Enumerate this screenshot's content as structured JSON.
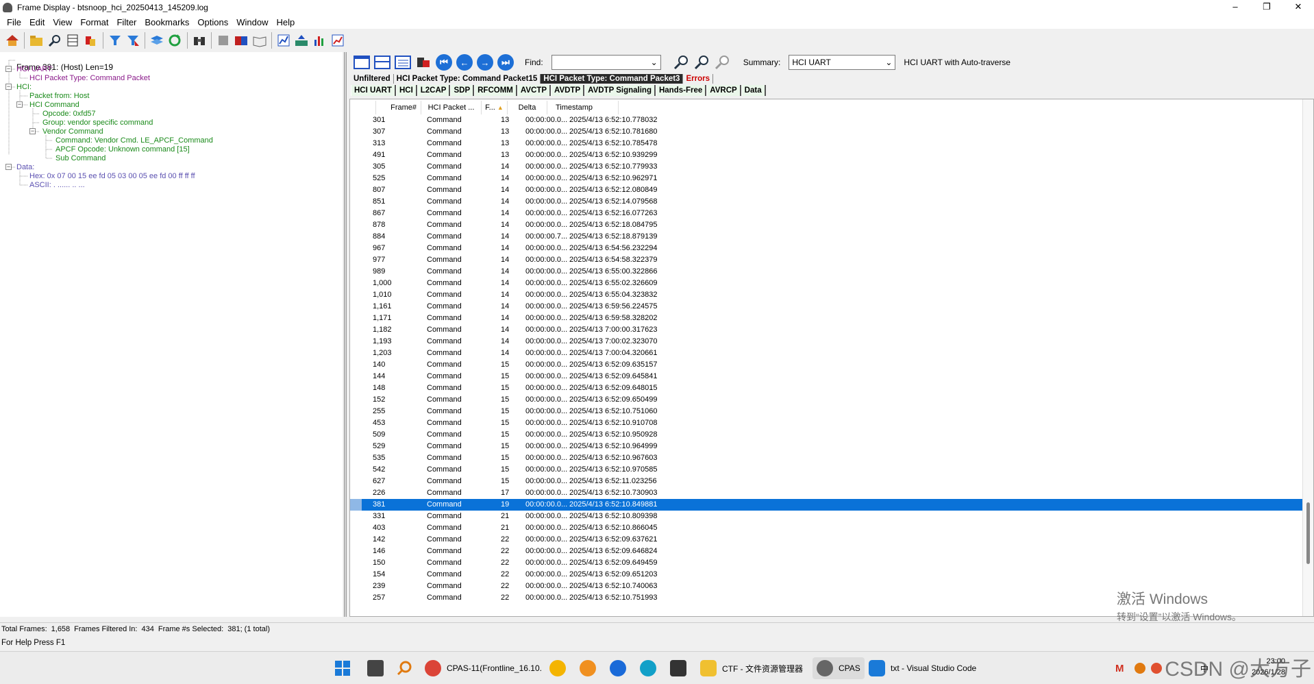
{
  "window": {
    "title": "Frame Display - btsnoop_hci_20250413_145209.log",
    "min": "–",
    "max": "❐",
    "close": "✕"
  },
  "menu": [
    "File",
    "Edit",
    "View",
    "Format",
    "Filter",
    "Bookmarks",
    "Options",
    "Window",
    "Help"
  ],
  "tree": {
    "frame": "Frame 381: (Host) Len=19",
    "hci_uart": "HCI UART:",
    "packet_type": "HCI Packet Type: Command Packet",
    "hci": "HCI:",
    "packet_from": "Packet from: Host",
    "hci_command": "HCI Command",
    "opcode": "Opcode: 0xfd57",
    "group": "Group: vendor specific command",
    "vendor_command": "Vendor Command",
    "command": "Command: Vendor Cmd. LE_APCF_Command",
    "apcf": "APCF Opcode: Unknown command [15]",
    "sub_command": "Sub Command",
    "data": "Data:",
    "hex": "Hex: 0x 07 00 15 ee fd 05 03 00 05 ee fd 00 ff ff ff",
    "ascii": "ASCII: . ...... .. ..."
  },
  "find": {
    "label": "Find:",
    "value": ""
  },
  "summary": {
    "label": "Summary:",
    "value": "HCI UART",
    "description": "HCI UART with Auto-traverse"
  },
  "filter_tabs": [
    {
      "label": "Unfiltered",
      "state": "normal"
    },
    {
      "label": "HCI Packet Type: Command Packet15",
      "state": "normal"
    },
    {
      "label": "HCI Packet Type: Command Packet3",
      "state": "active"
    },
    {
      "label": "Errors",
      "state": "error"
    }
  ],
  "protocol_tabs": [
    "HCI UART",
    "HCI",
    "L2CAP",
    "SDP",
    "RFCOMM",
    "AVCTP",
    "AVDTP",
    "AVDTP Signaling",
    "Hands-Free",
    "AVRCP",
    "Data"
  ],
  "columns": [
    "Frame#",
    "HCI Packet ...",
    "F...",
    "Delta",
    "Timestamp"
  ],
  "rows": [
    [
      "301",
      "Command",
      "13",
      "00:00:00.0...",
      "2025/4/13 6:52:10.778032"
    ],
    [
      "307",
      "Command",
      "13",
      "00:00:00.0...",
      "2025/4/13 6:52:10.781680"
    ],
    [
      "313",
      "Command",
      "13",
      "00:00:00.0...",
      "2025/4/13 6:52:10.785478"
    ],
    [
      "491",
      "Command",
      "13",
      "00:00:00.0...",
      "2025/4/13 6:52:10.939299"
    ],
    [
      "305",
      "Command",
      "14",
      "00:00:00.0...",
      "2025/4/13 6:52:10.779933"
    ],
    [
      "525",
      "Command",
      "14",
      "00:00:00.0...",
      "2025/4/13 6:52:10.962971"
    ],
    [
      "807",
      "Command",
      "14",
      "00:00:00.0...",
      "2025/4/13 6:52:12.080849"
    ],
    [
      "851",
      "Command",
      "14",
      "00:00:00.0...",
      "2025/4/13 6:52:14.079568"
    ],
    [
      "867",
      "Command",
      "14",
      "00:00:00.0...",
      "2025/4/13 6:52:16.077263"
    ],
    [
      "878",
      "Command",
      "14",
      "00:00:00.0...",
      "2025/4/13 6:52:18.084795"
    ],
    [
      "884",
      "Command",
      "14",
      "00:00:00.7...",
      "2025/4/13 6:52:18.879139"
    ],
    [
      "967",
      "Command",
      "14",
      "00:00:00.0...",
      "2025/4/13 6:54:56.232294"
    ],
    [
      "977",
      "Command",
      "14",
      "00:00:00.0...",
      "2025/4/13 6:54:58.322379"
    ],
    [
      "989",
      "Command",
      "14",
      "00:00:00.0...",
      "2025/4/13 6:55:00.322866"
    ],
    [
      "1,000",
      "Command",
      "14",
      "00:00:00.0...",
      "2025/4/13 6:55:02.326609"
    ],
    [
      "1,010",
      "Command",
      "14",
      "00:00:00.0...",
      "2025/4/13 6:55:04.323832"
    ],
    [
      "1,161",
      "Command",
      "14",
      "00:00:00.0...",
      "2025/4/13 6:59:56.224575"
    ],
    [
      "1,171",
      "Command",
      "14",
      "00:00:00.0...",
      "2025/4/13 6:59:58.328202"
    ],
    [
      "1,182",
      "Command",
      "14",
      "00:00:00.0...",
      "2025/4/13 7:00:00.317623"
    ],
    [
      "1,193",
      "Command",
      "14",
      "00:00:00.0...",
      "2025/4/13 7:00:02.323070"
    ],
    [
      "1,203",
      "Command",
      "14",
      "00:00:00.0...",
      "2025/4/13 7:00:04.320661"
    ],
    [
      "140",
      "Command",
      "15",
      "00:00:00.0...",
      "2025/4/13 6:52:09.635157"
    ],
    [
      "144",
      "Command",
      "15",
      "00:00:00.0...",
      "2025/4/13 6:52:09.645841"
    ],
    [
      "148",
      "Command",
      "15",
      "00:00:00.0...",
      "2025/4/13 6:52:09.648015"
    ],
    [
      "152",
      "Command",
      "15",
      "00:00:00.0...",
      "2025/4/13 6:52:09.650499"
    ],
    [
      "255",
      "Command",
      "15",
      "00:00:00.0...",
      "2025/4/13 6:52:10.751060"
    ],
    [
      "453",
      "Command",
      "15",
      "00:00:00.0...",
      "2025/4/13 6:52:10.910708"
    ],
    [
      "509",
      "Command",
      "15",
      "00:00:00.0...",
      "2025/4/13 6:52:10.950928"
    ],
    [
      "529",
      "Command",
      "15",
      "00:00:00.0...",
      "2025/4/13 6:52:10.964999"
    ],
    [
      "535",
      "Command",
      "15",
      "00:00:00.0...",
      "2025/4/13 6:52:10.967603"
    ],
    [
      "542",
      "Command",
      "15",
      "00:00:00.0...",
      "2025/4/13 6:52:10.970585"
    ],
    [
      "627",
      "Command",
      "15",
      "00:00:00.0...",
      "2025/4/13 6:52:11.023256"
    ],
    [
      "226",
      "Command",
      "17",
      "00:00:00.0...",
      "2025/4/13 6:52:10.730903"
    ],
    [
      "381",
      "Command",
      "19",
      "00:00:00.0...",
      "2025/4/13 6:52:10.849881"
    ],
    [
      "331",
      "Command",
      "21",
      "00:00:00.0...",
      "2025/4/13 6:52:10.809398"
    ],
    [
      "403",
      "Command",
      "21",
      "00:00:00.0...",
      "2025/4/13 6:52:10.866045"
    ],
    [
      "142",
      "Command",
      "22",
      "00:00:00.0...",
      "2025/4/13 6:52:09.637621"
    ],
    [
      "146",
      "Command",
      "22",
      "00:00:00.0...",
      "2025/4/13 6:52:09.646824"
    ],
    [
      "150",
      "Command",
      "22",
      "00:00:00.0...",
      "2025/4/13 6:52:09.649459"
    ],
    [
      "154",
      "Command",
      "22",
      "00:00:00.0...",
      "2025/4/13 6:52:09.651203"
    ],
    [
      "239",
      "Command",
      "22",
      "00:00:00.0...",
      "2025/4/13 6:52:10.740063"
    ],
    [
      "257",
      "Command",
      "22",
      "00:00:00.0...",
      "2025/4/13 6:52:10.751993"
    ]
  ],
  "selected_frame": "381",
  "status": {
    "total_label": "Total Frames:",
    "total": "1,658",
    "filtered_label": "Frames Filtered In:",
    "filtered": "434",
    "selected_label": "Frame #s Selected:",
    "selected": "381; (1 total)"
  },
  "help": "For Help Press F1",
  "watermark": {
    "line1": "激活 Windows",
    "line2": "转到“设置”以激活 Windows。"
  },
  "taskbar": {
    "chrome_cpas": "CPAS-11(Frontline_16.10.",
    "explorer": "CTF - 文件资源管理器",
    "cpas": "CPAS",
    "vscode": "txt - Visual Studio Code",
    "ime": "中",
    "time": "23:00",
    "date": "2026/1/28",
    "csdn": "CSDN @大方子"
  },
  "colors": {
    "selection": "#0a72d8",
    "tree_green": "#1a8a1a",
    "tree_purple": "#8a1a8a",
    "error_red": "#cc0000",
    "nav_blue": "#1d6fd6"
  }
}
